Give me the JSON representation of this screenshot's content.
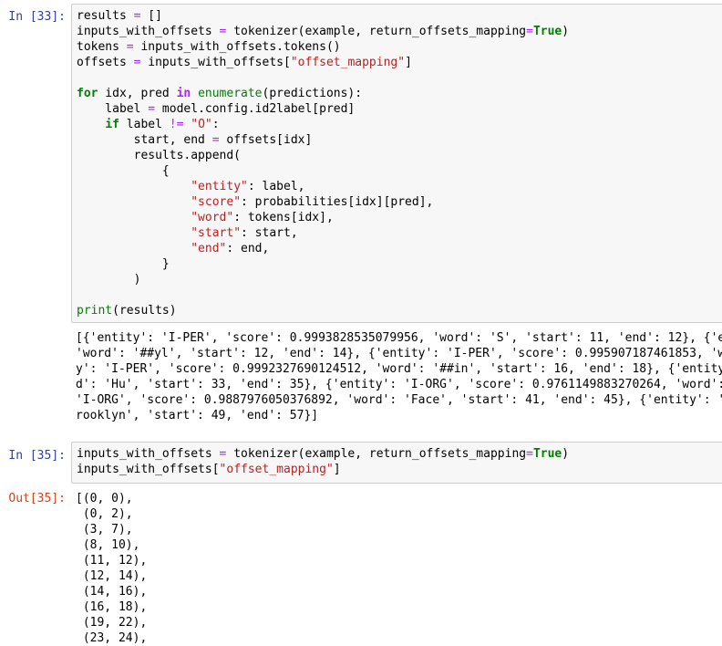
{
  "cells": [
    {
      "prompt": "In [33]:",
      "code": [
        [
          {
            "t": "results "
          },
          {
            "t": "=",
            "c": "eq"
          },
          {
            "t": " []"
          }
        ],
        [
          {
            "t": "inputs_with_offsets "
          },
          {
            "t": "=",
            "c": "eq"
          },
          {
            "t": " tokenizer(example, return_offsets_mapping"
          },
          {
            "t": "=",
            "c": "eq"
          },
          {
            "t": "True",
            "c": "kw"
          },
          {
            "t": ")"
          }
        ],
        [
          {
            "t": "tokens "
          },
          {
            "t": "=",
            "c": "eq"
          },
          {
            "t": " inputs_with_offsets.tokens()"
          }
        ],
        [
          {
            "t": "offsets "
          },
          {
            "t": "=",
            "c": "eq"
          },
          {
            "t": " inputs_with_offsets["
          },
          {
            "t": "\"offset_mapping\"",
            "c": "str"
          },
          {
            "t": "]"
          }
        ],
        [],
        [
          {
            "t": "for",
            "c": "kw"
          },
          {
            "t": " idx, pred "
          },
          {
            "t": "in",
            "c": "op"
          },
          {
            "t": " "
          },
          {
            "t": "enumerate",
            "c": "bi"
          },
          {
            "t": "(predictions):"
          }
        ],
        [
          {
            "t": "    label "
          },
          {
            "t": "=",
            "c": "eq"
          },
          {
            "t": " model.config.id2label[pred]"
          }
        ],
        [
          {
            "t": "    "
          },
          {
            "t": "if",
            "c": "kw"
          },
          {
            "t": " label "
          },
          {
            "t": "!=",
            "c": "eq"
          },
          {
            "t": " "
          },
          {
            "t": "\"O\"",
            "c": "str"
          },
          {
            "t": ":"
          }
        ],
        [
          {
            "t": "        start, end "
          },
          {
            "t": "=",
            "c": "eq"
          },
          {
            "t": " offsets[idx]"
          }
        ],
        [
          {
            "t": "        results.append("
          }
        ],
        [
          {
            "t": "            {"
          }
        ],
        [
          {
            "t": "                "
          },
          {
            "t": "\"entity\"",
            "c": "str"
          },
          {
            "t": ": label,"
          }
        ],
        [
          {
            "t": "                "
          },
          {
            "t": "\"score\"",
            "c": "str"
          },
          {
            "t": ": probabilities[idx][pred],"
          }
        ],
        [
          {
            "t": "                "
          },
          {
            "t": "\"word\"",
            "c": "str"
          },
          {
            "t": ": tokens[idx],"
          }
        ],
        [
          {
            "t": "                "
          },
          {
            "t": "\"start\"",
            "c": "str"
          },
          {
            "t": ": start,"
          }
        ],
        [
          {
            "t": "                "
          },
          {
            "t": "\"end\"",
            "c": "str"
          },
          {
            "t": ": end,"
          }
        ],
        [
          {
            "t": "            }"
          }
        ],
        [
          {
            "t": "        )"
          }
        ],
        [],
        [
          {
            "t": "print",
            "c": "bi"
          },
          {
            "t": "(results)"
          }
        ]
      ],
      "output_prompt": "",
      "output": [
        "[{'entity': 'I-PER', 'score': 0.9993828535079956, 'word': 'S', 'start': 11, 'end': 12}, {'entity': 'I-",
        "'word': '##yl', 'start': 12, 'end': 14}, {'entity': 'I-PER', 'score': 0.995907187461853, 'word': '##va",
        "y': 'I-PER', 'score': 0.9992327690124512, 'word': '##in', 'start': 16, 'end': 18}, {'entity': 'I-ORG'",
        "d': 'Hu', 'start': 33, 'end': 35}, {'entity': 'I-ORG', 'score': 0.9761149883270264, 'word': '##gging'",
        "'I-ORG', 'score': 0.9887976050376892, 'word': 'Face', 'start': 41, 'end': 45}, {'entity': 'I-LOC', 'sc",
        "rooklyn', 'start': 49, 'end': 57}]"
      ]
    },
    {
      "prompt": "In [35]:",
      "code": [
        [
          {
            "t": "inputs_with_offsets "
          },
          {
            "t": "=",
            "c": "eq"
          },
          {
            "t": " tokenizer(example, return_offsets_mapping"
          },
          {
            "t": "=",
            "c": "eq"
          },
          {
            "t": "True",
            "c": "kw"
          },
          {
            "t": ")"
          }
        ],
        [
          {
            "t": "inputs_with_offsets["
          },
          {
            "t": "\"offset_mapping\"",
            "c": "str"
          },
          {
            "t": "]"
          }
        ]
      ],
      "output_prompt": "Out[35]:",
      "output": [
        "[(0, 0),",
        " (0, 2),",
        " (3, 7),",
        " (8, 10),",
        " (11, 12),",
        " (12, 14),",
        " (14, 16),",
        " (16, 18),",
        " (19, 22),",
        " (23, 24),"
      ]
    }
  ]
}
